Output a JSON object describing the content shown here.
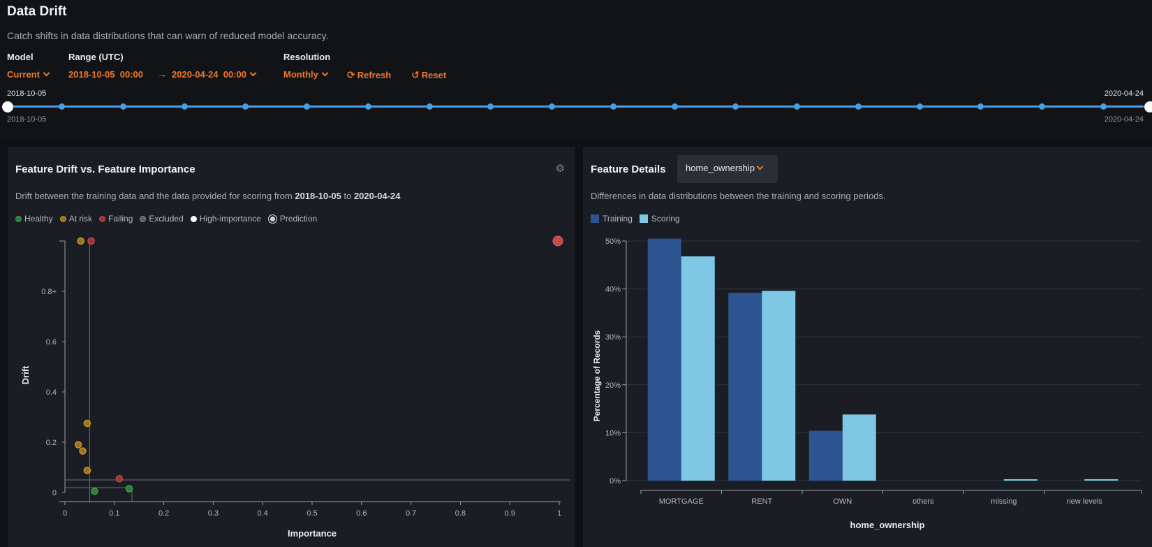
{
  "header": {
    "title": "Data Drift",
    "subtitle": "Catch shifts in data distributions that can warn of reduced model accuracy."
  },
  "controls": {
    "model_label": "Model",
    "model_value": "Current",
    "range_label": "Range (UTC)",
    "range_start": "2018-10-05  00:00",
    "range_arrow": "→",
    "range_end": "2020-04-24  00:00",
    "resolution_label": "Resolution",
    "resolution_value": "Monthly",
    "refresh_label": "Refresh",
    "reset_label": "Reset",
    "refresh_icon": "refresh-icon",
    "reset_icon": "undo-icon"
  },
  "timeline": {
    "start_top": "2018-10-05",
    "end_top": "2020-04-24",
    "start_bottom": "2018-10-05",
    "end_bottom": "2020-04-24",
    "tick_count": 18
  },
  "drift_panel": {
    "title": "Feature Drift vs. Feature Importance",
    "desc_prefix": "Drift between the training data and the data provided for scoring from",
    "desc_start": "2018-10-05",
    "desc_to": "to",
    "desc_end": "2020-04-24",
    "gear_icon": "gear-icon",
    "legend": [
      {
        "label": "Healthy",
        "color": "#3fa34d"
      },
      {
        "label": "At risk",
        "color": "#c9952b"
      },
      {
        "label": "Failing",
        "color": "#c94848"
      },
      {
        "label": "Excluded",
        "color": "#8a8f96"
      },
      {
        "label": "High-importance",
        "color": "#ffffff"
      },
      {
        "label": "Prediction",
        "color": "#d8dbe0"
      }
    ]
  },
  "details_panel": {
    "title": "Feature Details",
    "feature_select": "home_ownership",
    "desc": "Differences in data distributions between the training and scoring periods.",
    "legend": [
      {
        "label": "Training",
        "color": "#2b5491"
      },
      {
        "label": "Scoring",
        "color": "#7ec8e6"
      }
    ]
  },
  "chart_data": [
    {
      "type": "scatter",
      "title": "Feature Drift vs. Feature Importance",
      "xlabel": "Importance",
      "ylabel": "Drift",
      "xlim": [
        0,
        1
      ],
      "ylim": [
        0,
        1
      ],
      "x_ticks": [
        "0",
        "0.1",
        "0.2",
        "0.3",
        "0.4",
        "0.5",
        "0.6",
        "0.7",
        "0.8",
        "0.9",
        "1"
      ],
      "y_ticks": [
        "0",
        "0.2",
        "0.4",
        "0.6",
        "0.8+"
      ],
      "points": [
        {
          "x": 0.032,
          "y": 1.0,
          "status": "At risk"
        },
        {
          "x": 0.053,
          "y": 1.0,
          "status": "Failing"
        },
        {
          "x": 0.045,
          "y": 0.275,
          "status": "At risk"
        },
        {
          "x": 0.027,
          "y": 0.19,
          "status": "At risk"
        },
        {
          "x": 0.036,
          "y": 0.165,
          "status": "At risk"
        },
        {
          "x": 0.045,
          "y": 0.088,
          "status": "At risk"
        },
        {
          "x": 0.11,
          "y": 0.055,
          "status": "Failing"
        },
        {
          "x": 0.13,
          "y": 0.015,
          "status": "Healthy"
        },
        {
          "x": 0.06,
          "y": 0.005,
          "status": "Healthy"
        },
        {
          "x": 1.0,
          "y": 1.0,
          "status": "Failing",
          "prediction": true
        }
      ],
      "threshold_lines": {
        "drift": 0.05,
        "importance": 0.05
      }
    },
    {
      "type": "bar",
      "xlabel": "home_ownership",
      "ylabel": "Percentage of Records",
      "categories": [
        "MORTGAGE",
        "RENT",
        "OWN",
        "others",
        "missing",
        "new levels"
      ],
      "ylim": [
        0,
        50
      ],
      "y_ticks": [
        "0%",
        "10%",
        "20%",
        "30%",
        "40%",
        "50%"
      ],
      "series": [
        {
          "name": "Training",
          "values": [
            50.5,
            39.2,
            10.4,
            0,
            0,
            0
          ]
        },
        {
          "name": "Scoring",
          "values": [
            46.8,
            39.6,
            13.8,
            0,
            0.2,
            0.2
          ]
        }
      ]
    }
  ]
}
